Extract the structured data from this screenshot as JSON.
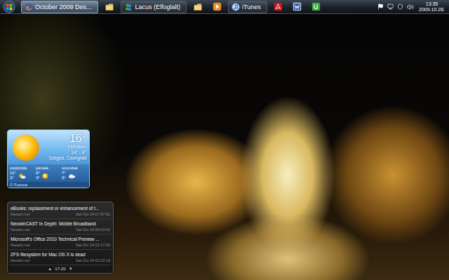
{
  "taskbar": {
    "items": [
      {
        "kind": "labeled",
        "label": "October 2009 Des...",
        "selected": true
      },
      {
        "kind": "icon",
        "selected": false
      },
      {
        "kind": "labeled",
        "label": "Lacus (Elfoglalt)",
        "selected": false
      },
      {
        "kind": "icon",
        "selected": false
      },
      {
        "kind": "icon",
        "selected": false
      },
      {
        "kind": "labeled",
        "label": "iTunes",
        "selected": false
      },
      {
        "kind": "icon",
        "selected": false
      },
      {
        "kind": "icon",
        "selected": false
      },
      {
        "kind": "icon",
        "selected": false
      }
    ],
    "clock": {
      "time": "13:35",
      "date": "2009.10.28."
    }
  },
  "weather": {
    "temperature": "16°",
    "condition": "Felhőtlen",
    "range": "14° - 8°",
    "location": "Szeged, Csongrád",
    "forecast": [
      {
        "day": "csütörtök",
        "high": "11°",
        "low": "3°"
      },
      {
        "day": "péntek",
        "high": "9°",
        "low": "3°"
      },
      {
        "day": "szombat",
        "high": "7°",
        "low": "5°"
      }
    ],
    "credit": "© Foreca"
  },
  "feed": {
    "items": [
      {
        "title": "eBooks: replacement or enhancement of t...",
        "source": "Neowin.net",
        "date": "Sat Oct 24 07:57:51"
      },
      {
        "title": "NeowinCAST In Depth: Mobile Broadband",
        "source": "Neowin.net",
        "date": "Sat Oct 24 06:03:42"
      },
      {
        "title": "Microsoft's Office 2010 Technical Preview ...",
        "source": "Neowin.net",
        "date": "Sat Oct 24 02:17:00"
      },
      {
        "title": "ZFS filesystem for Mac OS X is dead",
        "source": "Neowin.net",
        "date": "Sat Oct 24 02:10:19"
      }
    ],
    "prev": "▲",
    "page": "17-20",
    "next": "▼"
  }
}
